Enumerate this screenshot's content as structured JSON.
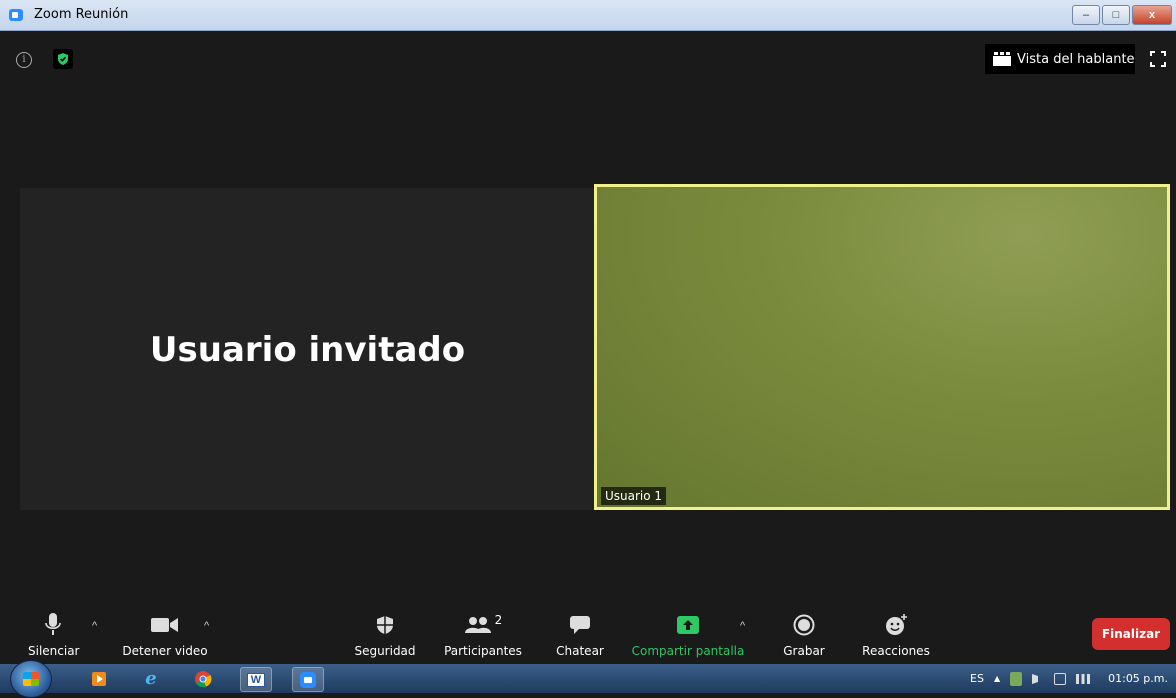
{
  "window": {
    "title": "Zoom Reunión",
    "minimize": "–",
    "maximize": "□",
    "close": "x"
  },
  "top": {
    "info": "i",
    "view_label": "Vista del hablante"
  },
  "tiles": {
    "guest_name": "Usuario invitado",
    "video_label": "Usuario 1"
  },
  "toolbar": {
    "mute": "Silenciar",
    "stop_video": "Detener video",
    "security": "Seguridad",
    "participants": "Participantes",
    "participants_count": "2",
    "chat": "Chatear",
    "share": "Compartir pantalla",
    "record": "Grabar",
    "reactions": "Reacciones",
    "end": "Finalizar",
    "caret": "^"
  },
  "taskbar": {
    "lang": "ES",
    "time": "01:05 p.m.",
    "tray_up": "▲"
  },
  "colors": {
    "accent_green": "#2ec866",
    "active_border": "#f1f08b",
    "end_red": "#d32f2f"
  }
}
